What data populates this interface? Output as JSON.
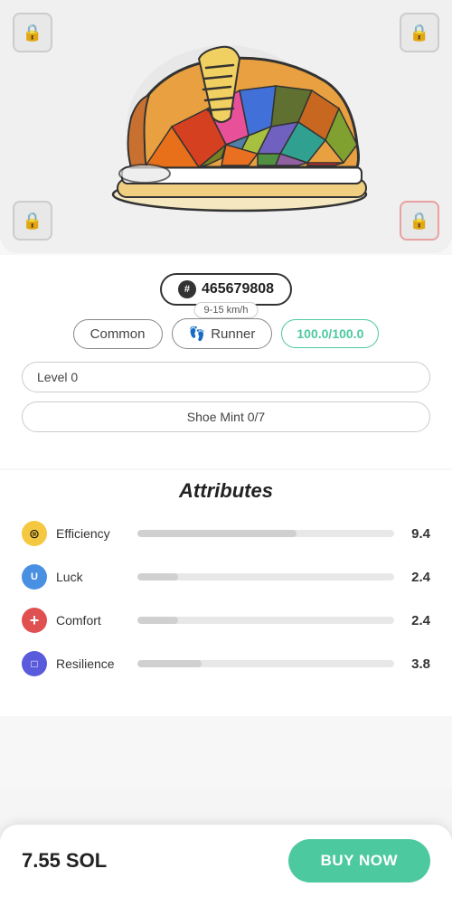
{
  "shoe": {
    "id": "465679808",
    "speed_range": "9-15 km/h",
    "rarity": "Common",
    "type": "Runner",
    "durability": "100.0/100.0",
    "level": "Level 0",
    "mint": "Shoe Mint 0/7",
    "price": "7.55 SOL",
    "buy_label": "BUY NOW",
    "attributes_title": "Attributes",
    "attributes": [
      {
        "name": "Efficiency",
        "value": "9.4",
        "bar_pct": 62,
        "icon": "⊜"
      },
      {
        "name": "Luck",
        "value": "2.4",
        "bar_pct": 16,
        "icon": "U"
      },
      {
        "name": "Comfort",
        "value": "2.4",
        "bar_pct": 16,
        "icon": "+"
      },
      {
        "name": "Resilience",
        "value": "3.8",
        "bar_pct": 25,
        "icon": "□"
      }
    ],
    "locks": [
      {
        "pos": "tl",
        "color": "#cccccc"
      },
      {
        "pos": "tr",
        "color": "#cccccc"
      },
      {
        "pos": "bl",
        "color": "#cccccc"
      },
      {
        "pos": "br",
        "color": "#e8a0a0"
      }
    ]
  },
  "icons": {
    "hash": "#",
    "lock": "🔒",
    "footprint": "👣"
  }
}
